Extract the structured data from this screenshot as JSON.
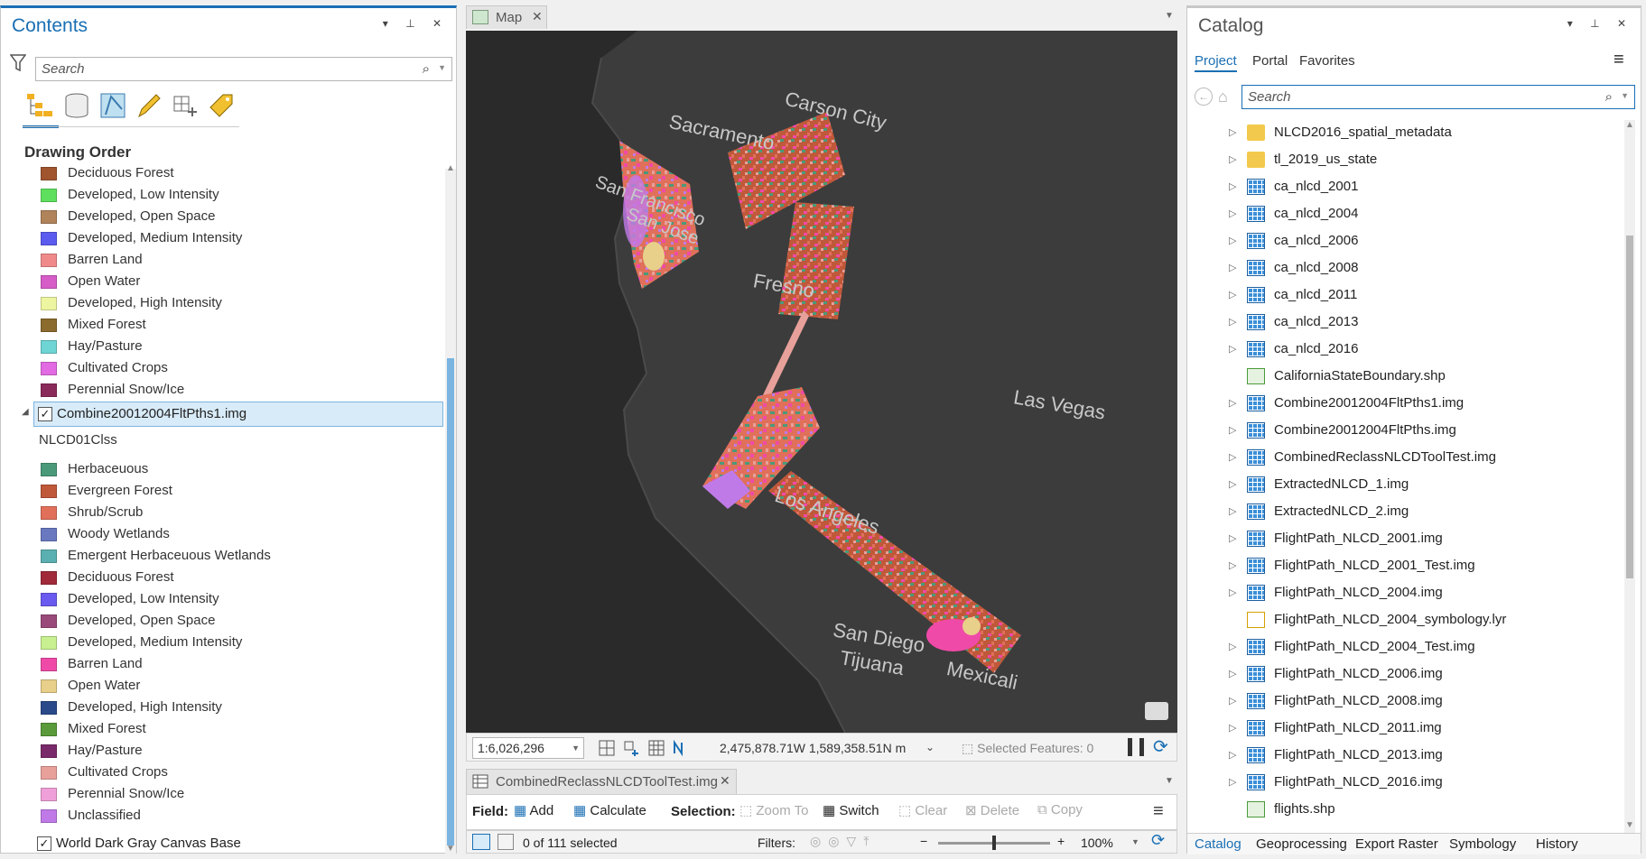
{
  "contents": {
    "title": "Contents",
    "search_placeholder": "Search",
    "drawing_order_heading": "Drawing Order",
    "layer1_items": [
      {
        "label": "Deciduous Forest",
        "color": "#a0552e"
      },
      {
        "label": "Developed, Low Intensity",
        "color": "#5ee05e"
      },
      {
        "label": "Developed, Open Space",
        "color": "#b0835a"
      },
      {
        "label": "Developed, Medium Intensity",
        "color": "#5b5bef"
      },
      {
        "label": "Barren Land",
        "color": "#f08a8a"
      },
      {
        "label": "Open Water",
        "color": "#d65cc8"
      },
      {
        "label": "Developed, High Intensity",
        "color": "#eef5a0"
      },
      {
        "label": "Mixed Forest",
        "color": "#8b6b2e"
      },
      {
        "label": "Hay/Pasture",
        "color": "#6ed4d4"
      },
      {
        "label": "Cultivated Crops",
        "color": "#e26ae2"
      },
      {
        "label": "Perennial Snow/Ice",
        "color": "#8a2a5a"
      }
    ],
    "layer2_name": "Combine20012004FltPths1.img",
    "layer2_field": "NLCD01Clss",
    "layer2_items": [
      {
        "label": "Herbaceuous",
        "color": "#4a9a7a"
      },
      {
        "label": "Evergreen Forest",
        "color": "#c0583a"
      },
      {
        "label": "Shrub/Scrub",
        "color": "#e0705a"
      },
      {
        "label": "Woody Wetlands",
        "color": "#6a78c0"
      },
      {
        "label": "Emergent Herbaceuous Wetlands",
        "color": "#5ab0b0"
      },
      {
        "label": "Deciduous Forest",
        "color": "#a02a3a"
      },
      {
        "label": "Developed, Low Intensity",
        "color": "#6a5aef"
      },
      {
        "label": "Developed, Open Space",
        "color": "#9a4a7a"
      },
      {
        "label": "Developed, Medium Intensity",
        "color": "#c8f090"
      },
      {
        "label": "Barren Land",
        "color": "#f04aa8"
      },
      {
        "label": "Open Water",
        "color": "#e8cf8a"
      },
      {
        "label": "Developed, High Intensity",
        "color": "#2a4a8a"
      },
      {
        "label": "Mixed Forest",
        "color": "#5a9a3a"
      },
      {
        "label": "Hay/Pasture",
        "color": "#7a2a6a"
      },
      {
        "label": "Cultivated Crops",
        "color": "#e8a09a"
      },
      {
        "label": "Perennial Snow/Ice",
        "color": "#f0a0d8"
      },
      {
        "label": "Unclassified",
        "color": "#c07ae8"
      }
    ],
    "basemap_name": "World Dark Gray Canvas Base"
  },
  "map": {
    "tab_label": "Map",
    "scale": "1:6,026,296",
    "coordinates": "2,475,878.71W 1,589,358.51N m",
    "selected_features": "Selected Features: 0",
    "labels": {
      "sacramento": "Sacramento",
      "carson": "Carson City",
      "sanfrancisco": "San Francisco",
      "sanjose": "San Jose",
      "fresno": "Fresno",
      "lasvegas": "Las Vegas",
      "losangeles": "Los Angeles",
      "sandiego": "San Diego",
      "tijuana": "Tijuana",
      "mexicali": "Mexicali"
    }
  },
  "table": {
    "tab_label": "CombinedReclassNLCDToolTest.img",
    "field_label": "Field:",
    "add_label": "Add",
    "calculate_label": "Calculate",
    "selection_label": "Selection:",
    "zoom_to_label": "Zoom To",
    "switch_label": "Switch",
    "clear_label": "Clear",
    "delete_label": "Delete",
    "copy_label": "Copy",
    "selected_count": "0 of 111 selected",
    "filters_label": "Filters:",
    "zoom_value": "100%"
  },
  "catalog": {
    "title": "Catalog",
    "tabs": [
      "Project",
      "Portal",
      "Favorites"
    ],
    "search_placeholder": "Search",
    "items": [
      {
        "name": "NLCD2016_spatial_metadata",
        "type": "folder",
        "expand": true
      },
      {
        "name": "tl_2019_us_state",
        "type": "folder",
        "expand": true
      },
      {
        "name": "ca_nlcd_2001",
        "type": "raster",
        "expand": true
      },
      {
        "name": "ca_nlcd_2004",
        "type": "raster",
        "expand": true
      },
      {
        "name": "ca_nlcd_2006",
        "type": "raster",
        "expand": true
      },
      {
        "name": "ca_nlcd_2008",
        "type": "raster",
        "expand": true
      },
      {
        "name": "ca_nlcd_2011",
        "type": "raster",
        "expand": true
      },
      {
        "name": "ca_nlcd_2013",
        "type": "raster",
        "expand": true
      },
      {
        "name": "ca_nlcd_2016",
        "type": "raster",
        "expand": true
      },
      {
        "name": "CaliforniaStateBoundary.shp",
        "type": "shp",
        "expand": false
      },
      {
        "name": "Combine20012004FltPths1.img",
        "type": "raster",
        "expand": true
      },
      {
        "name": "Combine20012004FltPths.img",
        "type": "raster",
        "expand": true
      },
      {
        "name": "CombinedReclassNLCDToolTest.img",
        "type": "raster",
        "expand": true
      },
      {
        "name": "ExtractedNLCD_1.img",
        "type": "raster",
        "expand": true
      },
      {
        "name": "ExtractedNLCD_2.img",
        "type": "raster",
        "expand": true
      },
      {
        "name": "FlightPath_NLCD_2001.img",
        "type": "raster",
        "expand": true
      },
      {
        "name": "FlightPath_NLCD_2001_Test.img",
        "type": "raster",
        "expand": true
      },
      {
        "name": "FlightPath_NLCD_2004.img",
        "type": "raster",
        "expand": true
      },
      {
        "name": "FlightPath_NLCD_2004_symbology.lyr",
        "type": "lyr",
        "expand": false
      },
      {
        "name": "FlightPath_NLCD_2004_Test.img",
        "type": "raster",
        "expand": true
      },
      {
        "name": "FlightPath_NLCD_2006.img",
        "type": "raster",
        "expand": true
      },
      {
        "name": "FlightPath_NLCD_2008.img",
        "type": "raster",
        "expand": true
      },
      {
        "name": "FlightPath_NLCD_2011.img",
        "type": "raster",
        "expand": true
      },
      {
        "name": "FlightPath_NLCD_2013.img",
        "type": "raster",
        "expand": true
      },
      {
        "name": "FlightPath_NLCD_2016.img",
        "type": "raster",
        "expand": true
      },
      {
        "name": "flights.shp",
        "type": "shp",
        "expand": false
      }
    ],
    "bottom_tabs": [
      "Catalog",
      "Geoprocessing",
      "Export Raster",
      "Symbology",
      "History"
    ]
  },
  "colors": {
    "accent": "#1a6fb4",
    "map_bg": "#2a2a2a",
    "land": "#3a3a3a"
  }
}
